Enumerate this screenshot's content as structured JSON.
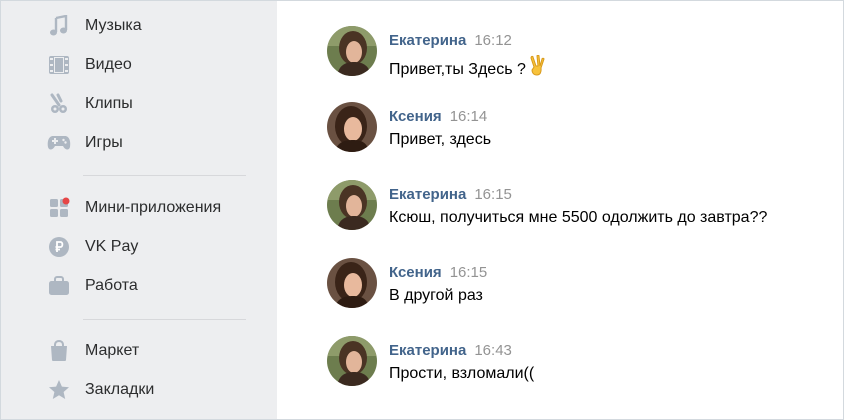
{
  "sidebar": {
    "items": [
      {
        "label": "Музыка",
        "icon": "music-note-icon"
      },
      {
        "label": "Видео",
        "icon": "film-strip-icon"
      },
      {
        "label": "Клипы",
        "icon": "clips-icon"
      },
      {
        "label": "Игры",
        "icon": "gamepad-icon"
      },
      {
        "label": "Мини-приложения",
        "icon": "mini-apps-icon"
      },
      {
        "label": "VK Pay",
        "icon": "ruble-coin-icon"
      },
      {
        "label": "Работа",
        "icon": "briefcase-icon"
      },
      {
        "label": "Маркет",
        "icon": "shopping-bag-icon"
      },
      {
        "label": "Закладки",
        "icon": "star-icon"
      }
    ],
    "icon_color": "#aeb7c2",
    "background": "#edeef0"
  },
  "messages": [
    {
      "author": "Екатерина",
      "time": "16:12",
      "text": "Привет,ты Здесь ?",
      "emoji": "victory-hand-icon"
    },
    {
      "author": "Ксения",
      "time": "16:14",
      "text": "Привет, здесь"
    },
    {
      "author": "Екатерина",
      "time": "16:15",
      "text": "Ксюш, получиться мне 5500 одолжить до завтра??"
    },
    {
      "author": "Ксения",
      "time": "16:15",
      "text": "В другой раз"
    },
    {
      "author": "Екатерина",
      "time": "16:43",
      "text": "Прости, взломали(("
    }
  ],
  "colors": {
    "author": "#42648b",
    "time": "#939393",
    "notification_dot": "#e64646"
  }
}
